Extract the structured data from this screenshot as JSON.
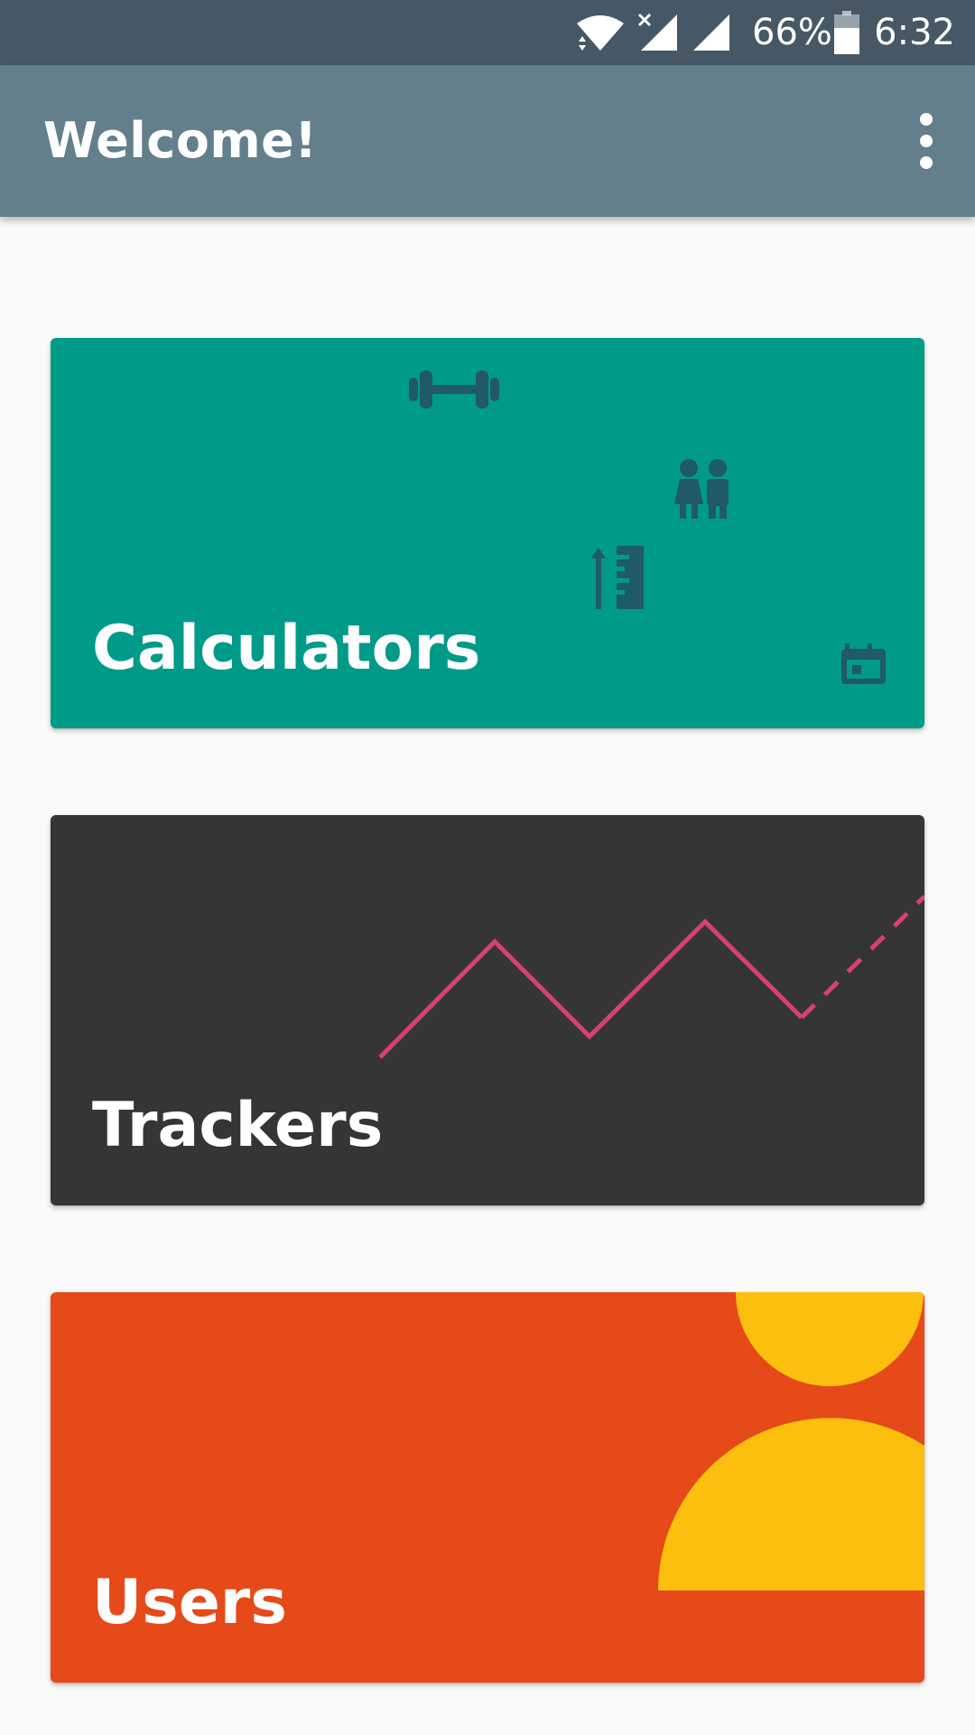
{
  "status_bar": {
    "battery_percent": "66%",
    "time": "6:32",
    "icons": [
      "wifi-icon",
      "no-sim-signal-icon",
      "signal-icon",
      "battery-icon"
    ]
  },
  "app_bar": {
    "title": "Welcome!",
    "menu_icon": "overflow-menu-icon"
  },
  "cards": [
    {
      "title": "Calculators",
      "color": "#009a88",
      "icon_color": "#1f5a66",
      "icons": [
        "dumbbell-icon",
        "people-icon",
        "height-ruler-icon",
        "calendar-icon"
      ]
    },
    {
      "title": "Trackers",
      "color": "#353535",
      "line_color": "#d7416f"
    },
    {
      "title": "Users",
      "color": "#e64a19",
      "accent_color": "#fdbf0e"
    }
  ]
}
